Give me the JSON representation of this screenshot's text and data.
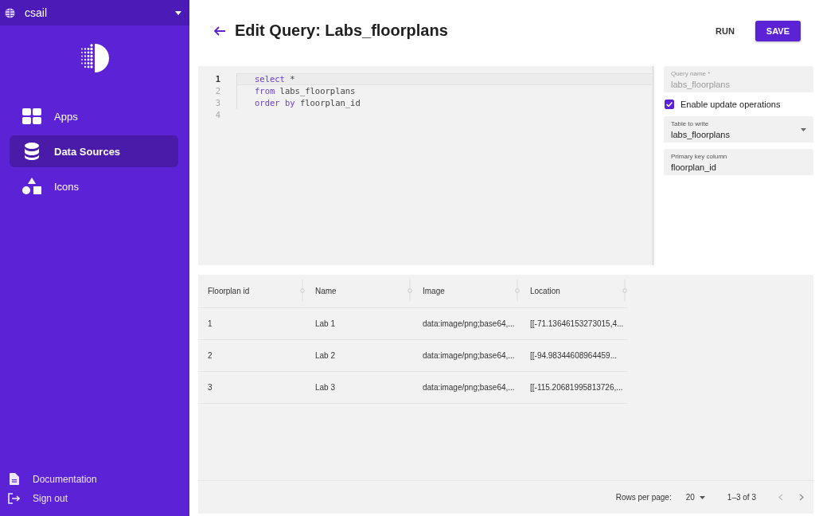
{
  "sidebar": {
    "org": "csail",
    "nav": [
      {
        "label": "Apps",
        "selected": false
      },
      {
        "label": "Data Sources",
        "selected": true
      },
      {
        "label": "Icons",
        "selected": false
      }
    ],
    "footer": [
      {
        "label": "Documentation"
      },
      {
        "label": "Sign out"
      }
    ]
  },
  "header": {
    "title": "Edit Query: Labs_floorplans",
    "buttons": [
      {
        "label": "RUN",
        "kind": "text"
      },
      {
        "label": "SAVE",
        "kind": "filled"
      }
    ]
  },
  "editor": {
    "lines": [
      {
        "number": "1",
        "active": true,
        "tokens": [
          {
            "text": "select",
            "kind": "keyword"
          },
          {
            "text": " *",
            "kind": "plain"
          }
        ]
      },
      {
        "number": "2",
        "active": false,
        "tokens": [
          {
            "text": "from",
            "kind": "keyword"
          },
          {
            "text": " labs_floorplans",
            "kind": "plain"
          }
        ]
      },
      {
        "number": "3",
        "active": false,
        "tokens": [
          {
            "text": "order by",
            "kind": "keyword"
          },
          {
            "text": " floorplan_id",
            "kind": "plain"
          }
        ]
      },
      {
        "number": "4",
        "active": false
      }
    ]
  },
  "settings": {
    "query_name": {
      "label": "Query name *",
      "value": "labs_floorplans",
      "disabled": true
    },
    "enable_update": {
      "label": "Enable update operations",
      "checked": true
    },
    "table_to_write": {
      "label": "Table to write",
      "value": "labs_floorplans"
    },
    "primary_key": {
      "label": "Primary key column",
      "value": "floorplan_id"
    }
  },
  "table": {
    "columns": [
      "Floorplan id",
      "Name",
      "Image",
      "Location"
    ],
    "rows": [
      [
        "1",
        "Lab 1",
        "data:image/png;base64,...",
        "[[-71.13646153273015,4..."
      ],
      [
        "2",
        "Lab 2",
        "data:image/png;base64,...",
        "[[-94.98344608964459..."
      ],
      [
        "3",
        "Lab 3",
        "data:image/png;base64,...",
        "[[-115.20681995813726,..."
      ]
    ],
    "footer": {
      "rows_per_page_label": "Rows per page:",
      "rows_per_page": "20",
      "range": "1–3 of 3"
    }
  }
}
